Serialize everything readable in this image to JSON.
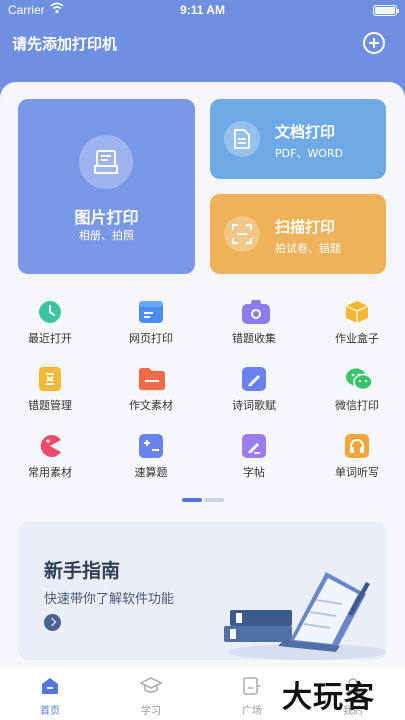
{
  "status_bar": {
    "carrier": "Carrier",
    "time": "9:11 AM"
  },
  "header": {
    "title": "请先添加打印机",
    "add_icon": "plus-circle-icon"
  },
  "feature_cards": {
    "photo": {
      "title": "图片打印",
      "subtitle": "相册、拍照",
      "icon": "photo-print-icon",
      "color": "#7a98e8"
    },
    "document": {
      "title": "文档打印",
      "subtitle": "PDF、WORD",
      "icon": "document-icon",
      "color": "#70aae6"
    },
    "scan": {
      "title": "扫描打印",
      "subtitle": "拍试卷、错题",
      "icon": "scan-icon",
      "color": "#efb25a"
    }
  },
  "tools": [
    {
      "label": "最近打开",
      "icon": "clock-icon",
      "color": "#3cc6a0"
    },
    {
      "label": "网页打印",
      "icon": "browser-icon",
      "color": "#4a8ff0"
    },
    {
      "label": "错题收集",
      "icon": "camera-icon",
      "color": "#8c7cf0"
    },
    {
      "label": "作业盒子",
      "icon": "box-icon",
      "color": "#f5b832"
    },
    {
      "label": "错题管理",
      "icon": "calculator-icon",
      "color": "#f7b83a"
    },
    {
      "label": "作文素材",
      "icon": "folder-icon",
      "color": "#f06a4a"
    },
    {
      "label": "诗词歌赋",
      "icon": "pen-icon",
      "color": "#6a82f0"
    },
    {
      "label": "微信打印",
      "icon": "wechat-icon",
      "color": "#3cc46a"
    },
    {
      "label": "常用素材",
      "icon": "pacman-icon",
      "color": "#f04a6a"
    },
    {
      "label": "速算题",
      "icon": "plus-minus-icon",
      "color": "#6a82f0"
    },
    {
      "label": "字帖",
      "icon": "edit-icon",
      "color": "#9a7ef0"
    },
    {
      "label": "单词听写",
      "icon": "headphones-icon",
      "color": "#f5a63a"
    }
  ],
  "guide": {
    "title": "新手指南",
    "subtitle": "快速带你了解软件功能",
    "arrow_icon": "arrow-right-icon"
  },
  "tabbar": {
    "tabs": [
      {
        "label": "首页",
        "icon": "home-icon",
        "active": true
      },
      {
        "label": "学习",
        "icon": "graduation-cap-icon",
        "active": false
      },
      {
        "label": "广场",
        "icon": "square-icon",
        "active": false
      },
      {
        "label": "我的",
        "icon": "profile-icon",
        "active": false
      }
    ]
  },
  "watermark": "大玩客"
}
